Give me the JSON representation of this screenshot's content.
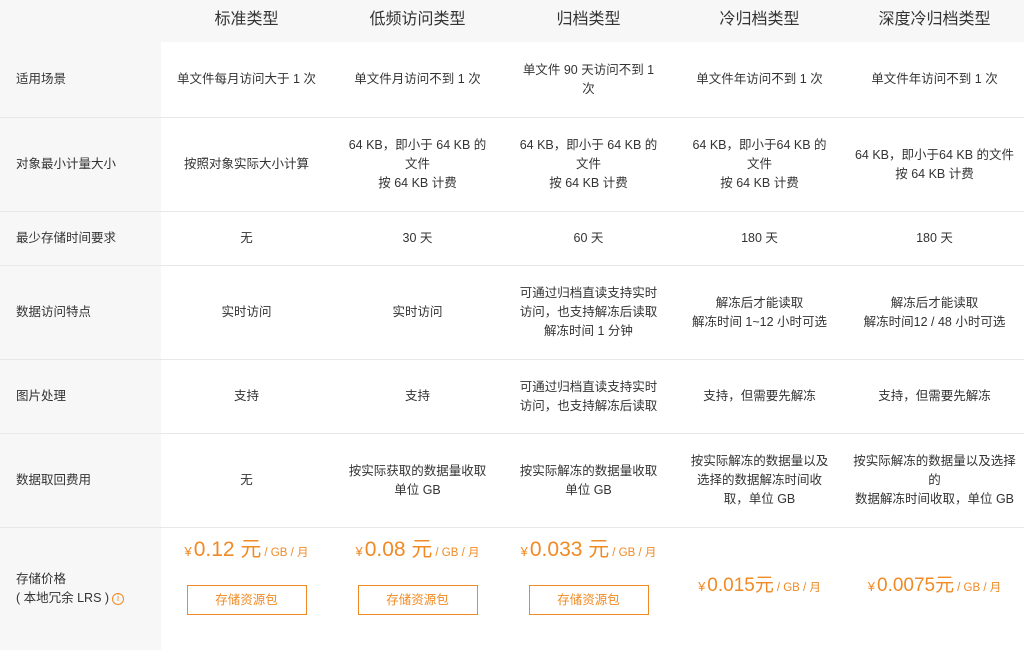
{
  "columns": [
    "标准类型",
    "低频访问类型",
    "归档类型",
    "冷归档类型",
    "深度冷归档类型"
  ],
  "rows": [
    {
      "label": "适用场景",
      "cells": [
        "单文件每月访问大于 1 次",
        "单文件月访问不到 1 次",
        "单文件 90 天访问不到 1\n次",
        "单文件年访问不到 1 次",
        "单文件年访问不到 1 次"
      ]
    },
    {
      "label": "对象最小计量大小",
      "cells": [
        "按照对象实际大小计算",
        "64 KB，即小于 64 KB 的\n文件\n按 64 KB 计费",
        "64 KB，即小于 64 KB 的\n文件\n按 64 KB 计费",
        "64 KB，即小于64 KB 的\n文件\n按 64 KB 计费",
        "64 KB，即小于64 KB 的文件\n按 64 KB 计费"
      ]
    },
    {
      "label": "最少存储时间要求",
      "cells": [
        "无",
        "30 天",
        "60 天",
        "180 天",
        "180 天"
      ]
    },
    {
      "label": "数据访问特点",
      "cells": [
        "实时访问",
        "实时访问",
        "可通过归档直读支持实时\n访问，也支持解冻后读取\n解冻时间 1 分钟",
        "解冻后才能读取\n解冻时间 1~12 小时可选",
        "解冻后才能读取\n解冻时间12 / 48 小时可选"
      ]
    },
    {
      "label": "图片处理",
      "cells": [
        "支持",
        "支持",
        "可通过归档直读支持实时\n访问，也支持解冻后读取",
        "支持，但需要先解冻",
        "支持，但需要先解冻"
      ]
    },
    {
      "label": "数据取回费用",
      "cells": [
        "无",
        "按实际获取的数据量收取\n单位 GB",
        "按实际解冻的数据量收取\n单位 GB",
        "按实际解冻的数据量以及\n选择的数据解冻时间收\n取，单位 GB",
        "按实际解冻的数据量以及选择的\n数据解冻时间收取，单位 GB"
      ]
    }
  ],
  "price_row": {
    "label_line1": "存储价格",
    "label_line2": "( 本地冗余 LRS )",
    "info_icon": "info-circle-icon",
    "currency": "¥",
    "prices": [
      {
        "amount": "0.12 元",
        "unit": "/ GB / 月",
        "button": "存储资源包"
      },
      {
        "amount": "0.08 元",
        "unit": "/ GB / 月",
        "button": "存储资源包"
      },
      {
        "amount": "0.033 元",
        "unit": "/ GB / 月",
        "button": "存储资源包"
      },
      {
        "amount": "0.015元",
        "unit": "/ GB / 月"
      },
      {
        "amount": "0.0075元",
        "unit": "/ GB / 月"
      }
    ]
  },
  "colors": {
    "accent": "#f08a24",
    "header_bg": "#f7f7f7",
    "border": "#e8e8e8"
  }
}
